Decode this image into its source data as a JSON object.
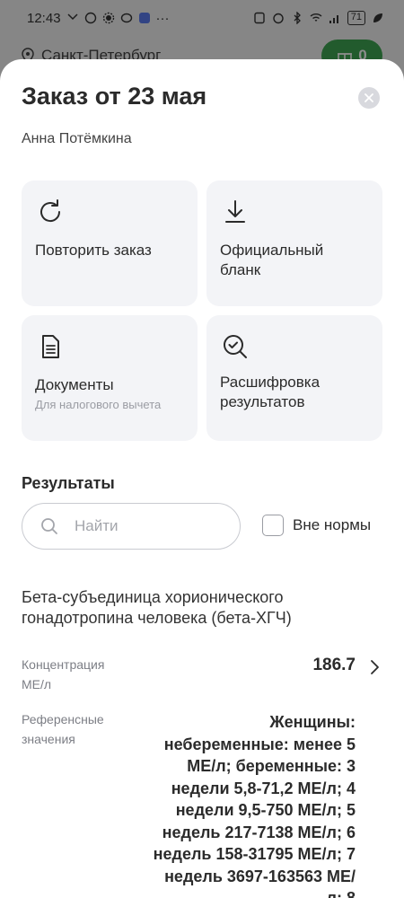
{
  "status_bar": {
    "time": "12:43",
    "battery": "71"
  },
  "background": {
    "city": "Санкт-Петербург",
    "gift_count": "0"
  },
  "sheet": {
    "title": "Заказ от 23 мая",
    "patient": "Анна Потёмкина",
    "actions": [
      {
        "label": "Повторить заказ",
        "sub": "",
        "icon": "refresh-icon"
      },
      {
        "label": "Официальный бланк",
        "sub": "",
        "icon": "download-icon"
      },
      {
        "label": "Документы",
        "sub": "Для налогового вычета",
        "icon": "document-icon"
      },
      {
        "label": "Расшифровка результатов",
        "sub": "",
        "icon": "magnifier-check-icon"
      }
    ],
    "results": {
      "title": "Результаты",
      "search_placeholder": "Найти",
      "filter_label": "Вне нормы",
      "filter_checked": false,
      "test": {
        "name": "Бета-субъединица хорионического гонадотропина человека (бета-ХГЧ)",
        "concentration_label": "Концентрация",
        "unit": "МЕ/л",
        "value": "186.7",
        "reference_label": "Референсные значения",
        "reference_text": "Женщины: небеременные: менее 5 МЕ/л; беременные: 3 недели 5,8-71,2 МЕ/л; 4 недели 9,5-750 МЕ/л; 5 недель 217-7138 МЕ/л; 6 недель 158-31795 МЕ/л; 7 недель 3697-163563 МЕ/л; 8"
      }
    }
  },
  "colors": {
    "accent_green": "#3fa652",
    "card_bg": "#f3f4f7",
    "text": "#2b2b2b",
    "muted": "#9a9ca3"
  }
}
